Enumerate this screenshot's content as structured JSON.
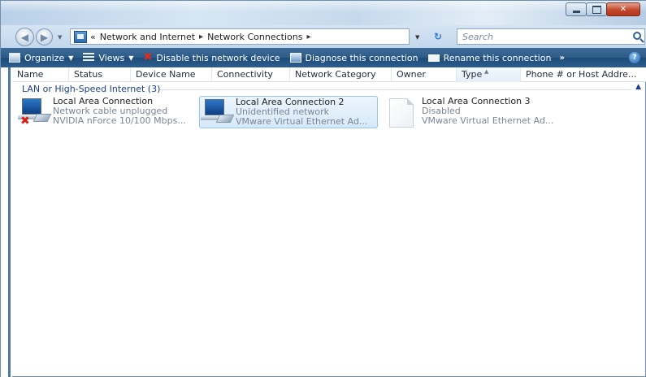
{
  "window": {
    "caption": {
      "min": "",
      "max": "",
      "close": "✕"
    }
  },
  "address": {
    "prefix": "«",
    "crumbs": [
      "Network and Internet",
      "Network Connections"
    ],
    "separator": "▸",
    "search_placeholder": "Search"
  },
  "toolbar": {
    "organize": "Organize",
    "views": "Views",
    "disable": "Disable this network device",
    "diagnose": "Diagnose this connection",
    "rename": "Rename this connection",
    "more": "»",
    "help": "?"
  },
  "columns": [
    "Name",
    "Status",
    "Device Name",
    "Connectivity",
    "Network Category",
    "Owner",
    "Type",
    "Phone # or Host Addre..."
  ],
  "group": {
    "label": "LAN or High-Speed Internet (3)"
  },
  "connections": [
    {
      "name": "Local Area Connection",
      "status": "Network cable unplugged",
      "device": "NVIDIA nForce 10/100 Mbps...",
      "icon": "network-pc-icon",
      "disconnected": true
    },
    {
      "name": "Local Area Connection 2",
      "status": "Unidentified network",
      "device": "VMware Virtual Ethernet Ad...",
      "icon": "network-pc-icon",
      "selected": true
    },
    {
      "name": "Local Area Connection 3",
      "status": "Disabled",
      "device": "VMware Virtual Ethernet Ad...",
      "icon": "blank-document-icon"
    }
  ],
  "colors": {
    "toolbar": "#2c5b87",
    "group_text": "#1e3f8a",
    "selection": "#d6e9f9"
  }
}
